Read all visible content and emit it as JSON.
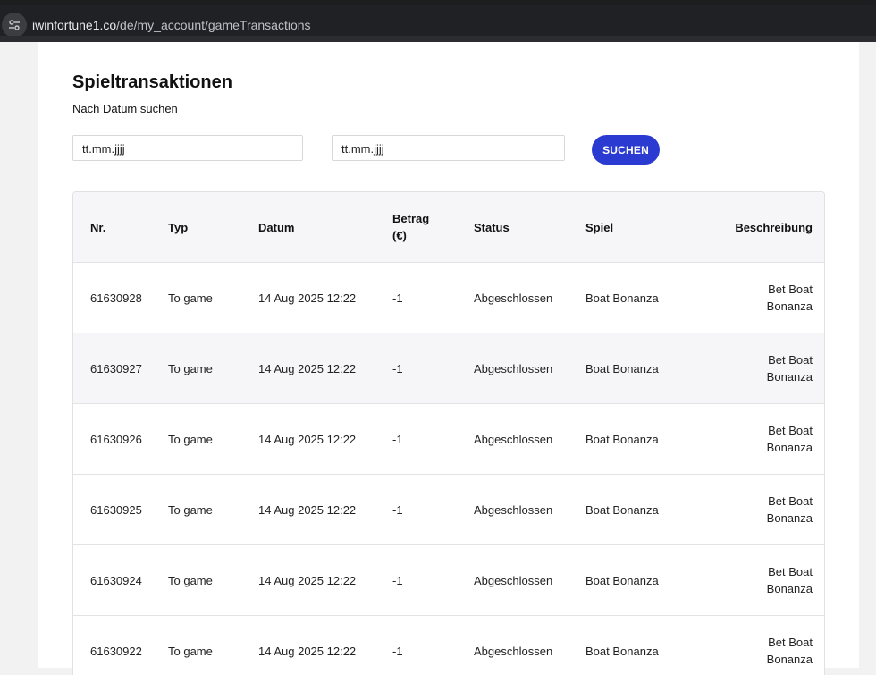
{
  "browser": {
    "url_host": "iwinfortune1.co",
    "url_path": "/de/my_account/gameTransactions"
  },
  "page": {
    "title": "Spieltransaktionen",
    "subtitle": "Nach Datum suchen",
    "date_from_placeholder": "tt.mm.jjjj",
    "date_to_placeholder": "tt.mm.jjjj",
    "search_label": "SUCHEN"
  },
  "table": {
    "headers": {
      "nr": "Nr.",
      "typ": "Typ",
      "datum": "Datum",
      "betrag": "Betrag (€)",
      "status": "Status",
      "spiel": "Spiel",
      "beschreibung": "Beschreibung"
    },
    "rows": [
      {
        "nr": "61630928",
        "typ": "To game",
        "datum": "14 Aug 2025 12:22",
        "betrag": "-1",
        "status": "Abgeschlossen",
        "spiel": "Boat Bonanza",
        "beschreibung": "Bet Boat Bonanza"
      },
      {
        "nr": "61630927",
        "typ": "To game",
        "datum": "14 Aug 2025 12:22",
        "betrag": "-1",
        "status": "Abgeschlossen",
        "spiel": "Boat Bonanza",
        "beschreibung": "Bet Boat Bonanza"
      },
      {
        "nr": "61630926",
        "typ": "To game",
        "datum": "14 Aug 2025 12:22",
        "betrag": "-1",
        "status": "Abgeschlossen",
        "spiel": "Boat Bonanza",
        "beschreibung": "Bet Boat Bonanza"
      },
      {
        "nr": "61630925",
        "typ": "To game",
        "datum": "14 Aug 2025 12:22",
        "betrag": "-1",
        "status": "Abgeschlossen",
        "spiel": "Boat Bonanza",
        "beschreibung": "Bet Boat Bonanza"
      },
      {
        "nr": "61630924",
        "typ": "To game",
        "datum": "14 Aug 2025 12:22",
        "betrag": "-1",
        "status": "Abgeschlossen",
        "spiel": "Boat Bonanza",
        "beschreibung": "Bet Boat Bonanza"
      },
      {
        "nr": "61630922",
        "typ": "To game",
        "datum": "14 Aug 2025 12:22",
        "betrag": "-1",
        "status": "Abgeschlossen",
        "spiel": "Boat Bonanza",
        "beschreibung": "Bet Boat Bonanza"
      }
    ]
  },
  "colors": {
    "accent": "#2b3bd1",
    "browser_bg": "#202124",
    "row_alt": "#f6f6f8"
  },
  "icons": {
    "site_info": "tune-icon"
  }
}
